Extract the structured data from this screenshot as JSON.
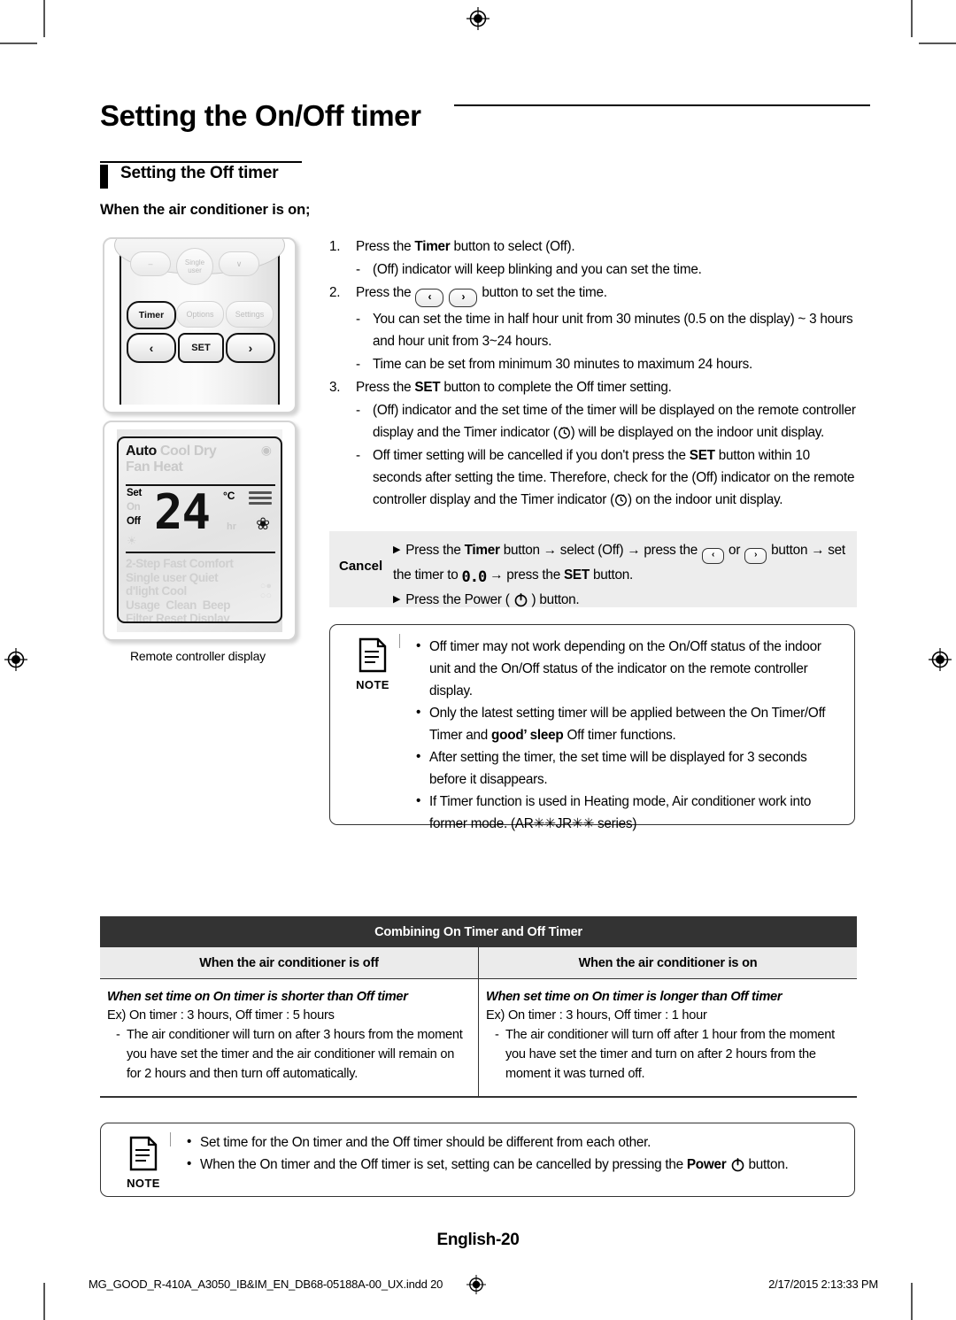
{
  "header": {
    "title": "Setting the On/Off timer",
    "section": "Setting the Off timer",
    "subsection": "When the air conditioner is on;"
  },
  "remote": {
    "caption": "Remote controller display",
    "buttons": {
      "minus": "–",
      "single_user": "Single user",
      "down": "∨",
      "timer": "Timer",
      "options": "Options",
      "settings": "Settings",
      "left": "‹",
      "set": "SET",
      "right": "›"
    },
    "display": {
      "mode_auto": "Auto",
      "mode_cool": "Cool",
      "mode_dry": "Dry",
      "mode_fan": "Fan",
      "mode_heat": "Heat",
      "label_set": "Set",
      "label_on": "On",
      "label_off": "Off",
      "value": "24",
      "unit": "°C",
      "hr": "hr",
      "opt_2step": "2-Step",
      "opt_fast": "Fast",
      "opt_comfort": "Comfort",
      "opt_single_user": "Single user",
      "opt_quiet": "Quiet",
      "opt_dlight_cool": "d'light Cool",
      "opt_usage": "Usage",
      "opt_clean": "Clean",
      "opt_beep": "Beep",
      "opt_filter": "Filter",
      "opt_reset": "Reset",
      "opt_display": "Display"
    }
  },
  "steps": [
    {
      "num": "1.",
      "text_html": "Press the <b>Timer</b> button to select (Off).",
      "subs": [
        "(Off) indicator will keep blinking and you can set the time."
      ]
    },
    {
      "num": "2.",
      "text_html": "Press the <span class=\"key\">‹</span> <span class=\"key\">›</span> button to set the time.",
      "subs": [
        "You can set the time in half hour unit from 30 minutes (0.5 on the display) ~ 3 hours and hour unit from 3~24 hours.",
        "Time can be set from minimum 30 minutes to maximum 24 hours."
      ]
    },
    {
      "num": "3.",
      "text_html": "Press the <b>SET</b> button to complete the Off timer setting.",
      "subs": [
        "(Off) indicator and the set time of the timer will be displayed on the remote controller display and the Timer indicator (⏱) will be displayed on the indoor unit display.",
        "Off timer setting will be cancelled if you don't press the <b>SET</b> button within 10 seconds after setting the time. Therefore, check for the (Off) indicator on the remote controller display and the Timer indicator (⏱) on the indoor unit display."
      ]
    }
  ],
  "cancel": {
    "label": "Cancel",
    "line1_html": "Press the <b>Timer</b> button → select (Off) → press the <span class=\"keysm\">‹</span> or <span class=\"keysm\">›</span> button → set the timer to <span class=\"zero-pair\">0.0</span> → press the <b>SET</b> button.",
    "line2_html": "Press the Power ( ⏻ ) button."
  },
  "note_top": {
    "label": "NOTE",
    "items": [
      "Off timer may not work depending on the On/Off status of the indoor unit and the On/Off status of the indicator on the remote controller display.",
      "Only the latest setting timer will be applied between the On Timer/Off Timer and <b>good’ sleep</b> Off timer functions.",
      "After setting the timer, the set time will be displayed for 3 seconds before it disappears.",
      "If Timer function is used in Heating mode, Air conditioner work into former mode. (AR✳✳JR✳✳ series)"
    ]
  },
  "table": {
    "title": "Combining On Timer and Off Timer",
    "columns": [
      "When the air conditioner is off",
      "When the air conditioner is on"
    ],
    "rows": [
      {
        "heading": "When set time on On timer is shorter than Off timer",
        "example": "Ex) On timer : 3 hours, Off timer : 5 hours",
        "detail": "The air conditioner will turn on after 3 hours from the moment you have set the timer and the air conditioner will remain on for 2 hours and then turn off automatically."
      },
      {
        "heading": "When set time on On timer is longer than Off timer",
        "example": "Ex) On timer : 3 hours, Off timer : 1 hour",
        "detail": "The air conditioner will turn off after 1 hour from the moment you have set the timer and turn on after 2 hours from the moment it was turned off."
      }
    ]
  },
  "note_bottom": {
    "label": "NOTE",
    "items": [
      "Set time for the On timer and the Off timer should be different from each other.",
      "When the On timer and the Off timer is set, setting can be cancelled by pressing the <b>Power</b> ⏻ button."
    ]
  },
  "footer": {
    "page_label": "English-20",
    "file": "MG_GOOD_R-410A_A3050_IB&IM_EN_DB68-05188A-00_UX.indd   20",
    "timestamp": "2/17/2015   2:13:33 PM"
  }
}
